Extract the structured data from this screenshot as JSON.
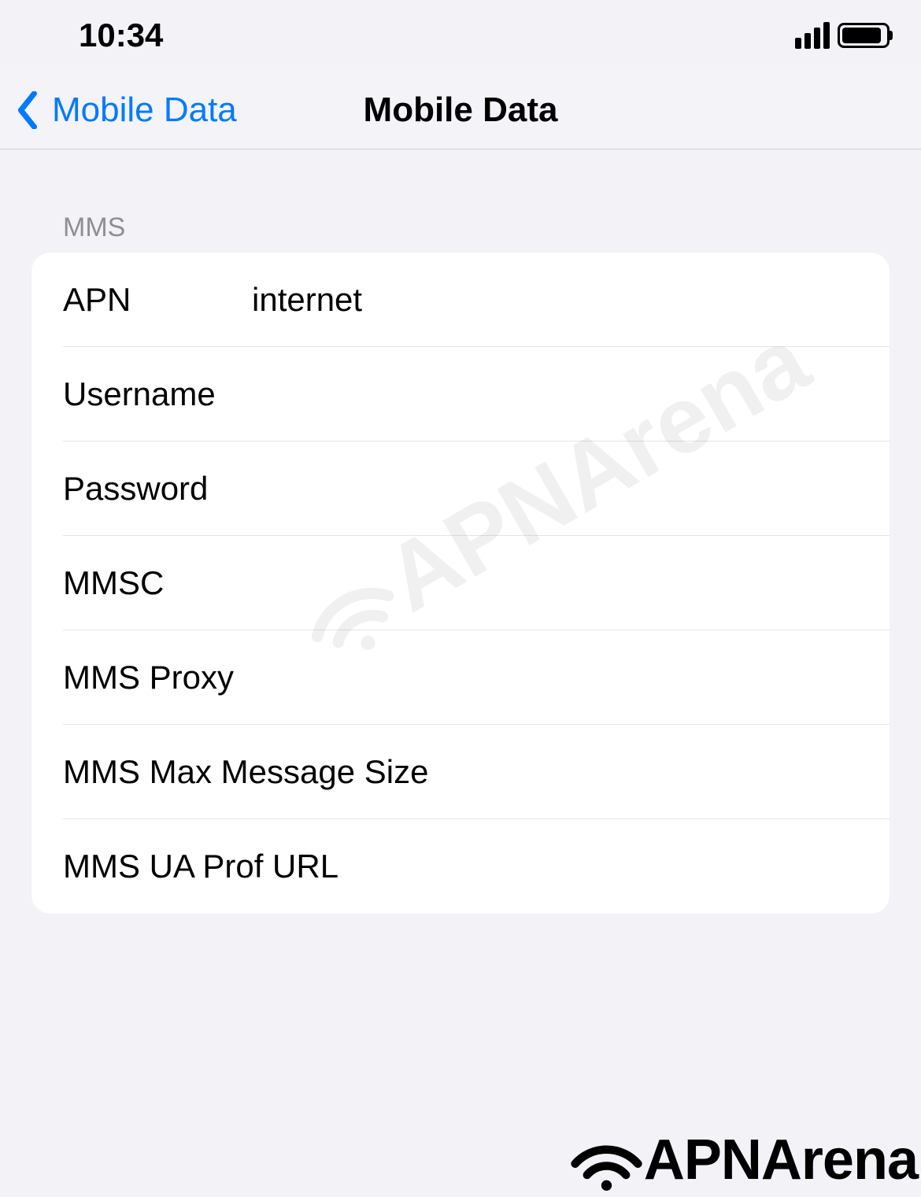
{
  "statusBar": {
    "time": "10:34"
  },
  "nav": {
    "backLabel": "Mobile Data",
    "title": "Mobile Data"
  },
  "section": {
    "header": "MMS"
  },
  "fields": {
    "apn": {
      "label": "APN",
      "value": "internet"
    },
    "username": {
      "label": "Username",
      "value": ""
    },
    "password": {
      "label": "Password",
      "value": ""
    },
    "mmsc": {
      "label": "MMSC",
      "value": ""
    },
    "mmsProxy": {
      "label": "MMS Proxy",
      "value": ""
    },
    "mmsMaxSize": {
      "label": "MMS Max Message Size",
      "value": ""
    },
    "mmsUaProf": {
      "label": "MMS UA Prof URL",
      "value": ""
    }
  },
  "watermark": {
    "text": "APNArena"
  },
  "brand": {
    "text": "APNArena"
  }
}
